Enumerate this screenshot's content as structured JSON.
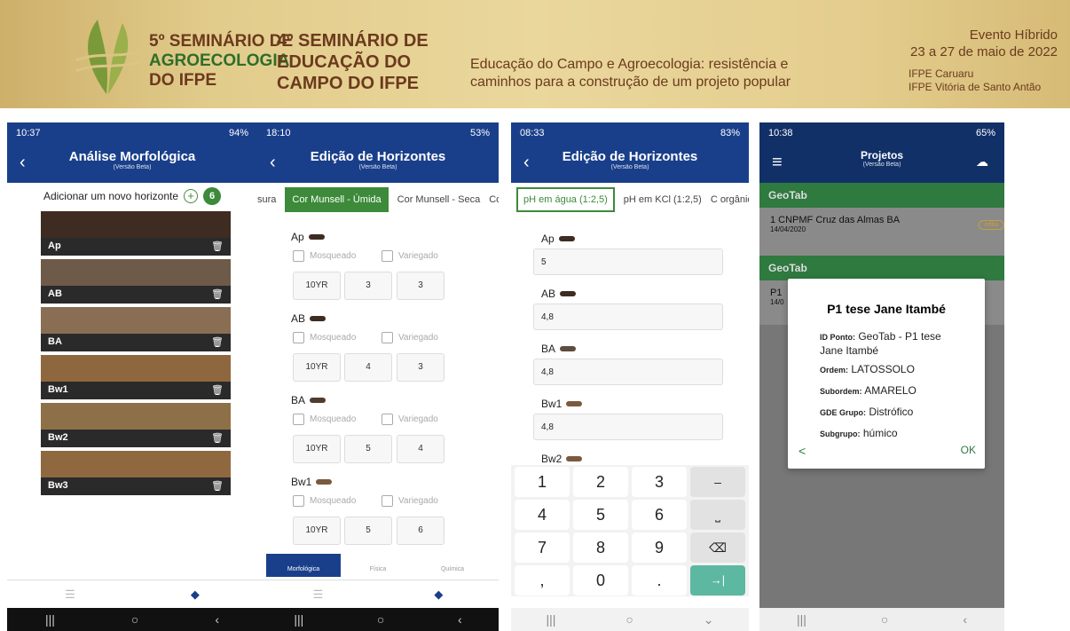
{
  "banner": {
    "sem5_l1": "5º SEMINÁRIO DE",
    "sem5_l2": "AGROECOLOGIA",
    "sem5_l3": "DO IFPE",
    "sem4_l1": "4º SEMINÁRIO DE",
    "sem4_l2": "EDUCAÇÃO DO",
    "sem4_l3": "CAMPO DO IFPE",
    "theme_l1": "Educação do Campo e Agroecologia: resistência e",
    "theme_l2": "caminhos para a construção de um projeto popular",
    "event_l1": "Evento Híbrido",
    "event_l2": "23 a 27 de maio de 2022",
    "loc_l1": "IFPE Caruaru",
    "loc_l2": "IFPE Vitória de Santo Antão"
  },
  "s1": {
    "time": "10:37",
    "battery": "94%",
    "title": "Análise Morfológica",
    "subtitle": "(Versão Beta)",
    "add": "Adicionar um novo horizonte",
    "count": "6",
    "horizons": [
      {
        "name": "Ap",
        "color": "#3e2c22"
      },
      {
        "name": "AB",
        "color": "#6e5a48"
      },
      {
        "name": "BA",
        "color": "#8a6e54"
      },
      {
        "name": "Bw1",
        "color": "#8f673e"
      },
      {
        "name": "Bw2",
        "color": "#8e7048"
      },
      {
        "name": "Bw3",
        "color": "#8f6840"
      }
    ]
  },
  "s2": {
    "time": "18:10",
    "battery": "53%",
    "title": "Edição de Horizontes",
    "subtitle": "(Versão Beta)",
    "tabs": [
      "sura",
      "Cor Munsell - Úmida",
      "Cor Munsell - Seca",
      "Cor"
    ],
    "mosq": "Mosqueado",
    "varieg": "Variegado",
    "horizons": [
      {
        "name": "Ap",
        "color": "#3e2c22",
        "hue": "10YR",
        "v": "3",
        "c": "3"
      },
      {
        "name": "AB",
        "color": "#3e2c22",
        "hue": "10YR",
        "v": "4",
        "c": "3"
      },
      {
        "name": "BA",
        "color": "#4e3c30",
        "hue": "10YR",
        "v": "5",
        "c": "4"
      },
      {
        "name": "Bw1",
        "color": "#7a5a3e",
        "hue": "10YR",
        "v": "5",
        "c": "6"
      }
    ],
    "bottom_tabs": [
      "Morfológica",
      "Física",
      "Química"
    ]
  },
  "s3": {
    "time": "08:33",
    "battery": "83%",
    "title": "Edição de Horizontes",
    "subtitle": "(Versão Beta)",
    "tabs": [
      "pH em água (1:2,5)",
      "pH em KCl (1:2,5)",
      "C orgânico"
    ],
    "horizons": [
      {
        "name": "Ap",
        "color": "#3e2c22",
        "value": "5"
      },
      {
        "name": "AB",
        "color": "#3e2c22",
        "value": "4,8"
      },
      {
        "name": "BA",
        "color": "#5e4c40",
        "value": "4,8"
      },
      {
        "name": "Bw1",
        "color": "#7a5a3e",
        "value": "4,8"
      },
      {
        "name": "Bw2",
        "color": "#7a5a3e",
        "value": ""
      }
    ],
    "keys": [
      "1",
      "2",
      "3",
      "–",
      "4",
      "5",
      "6",
      "⎵",
      "7",
      "8",
      "9",
      "⌫",
      ",",
      "0",
      ".",
      "→|"
    ]
  },
  "s4": {
    "time": "10:38",
    "battery": "65%",
    "title": "Projetos",
    "subtitle": "(Versão Beta)",
    "group1": "GeoTab",
    "item1": "1 CNPMF Cruz das Almas BA",
    "item1_date": "14/04/2020",
    "item1_badge": "edita",
    "group2": "GeoTab",
    "item2": "P1",
    "item2_date": "14/0",
    "dialog": {
      "title": "P1 tese Jane Itambé",
      "id_label": "ID Ponto:",
      "id_value": "GeoTab - P1 tese",
      "id_value2": "Jane Itambé",
      "ordem_label": "Ordem:",
      "ordem_value": "LATOSSOLO",
      "sub_label": "Subordem:",
      "sub_value": "AMARELO",
      "gde_label": "GDE Grupo:",
      "gde_value": "Distrófico",
      "subg_label": "Subgrupo:",
      "subg_value": "húmico",
      "ok": "OK"
    }
  }
}
